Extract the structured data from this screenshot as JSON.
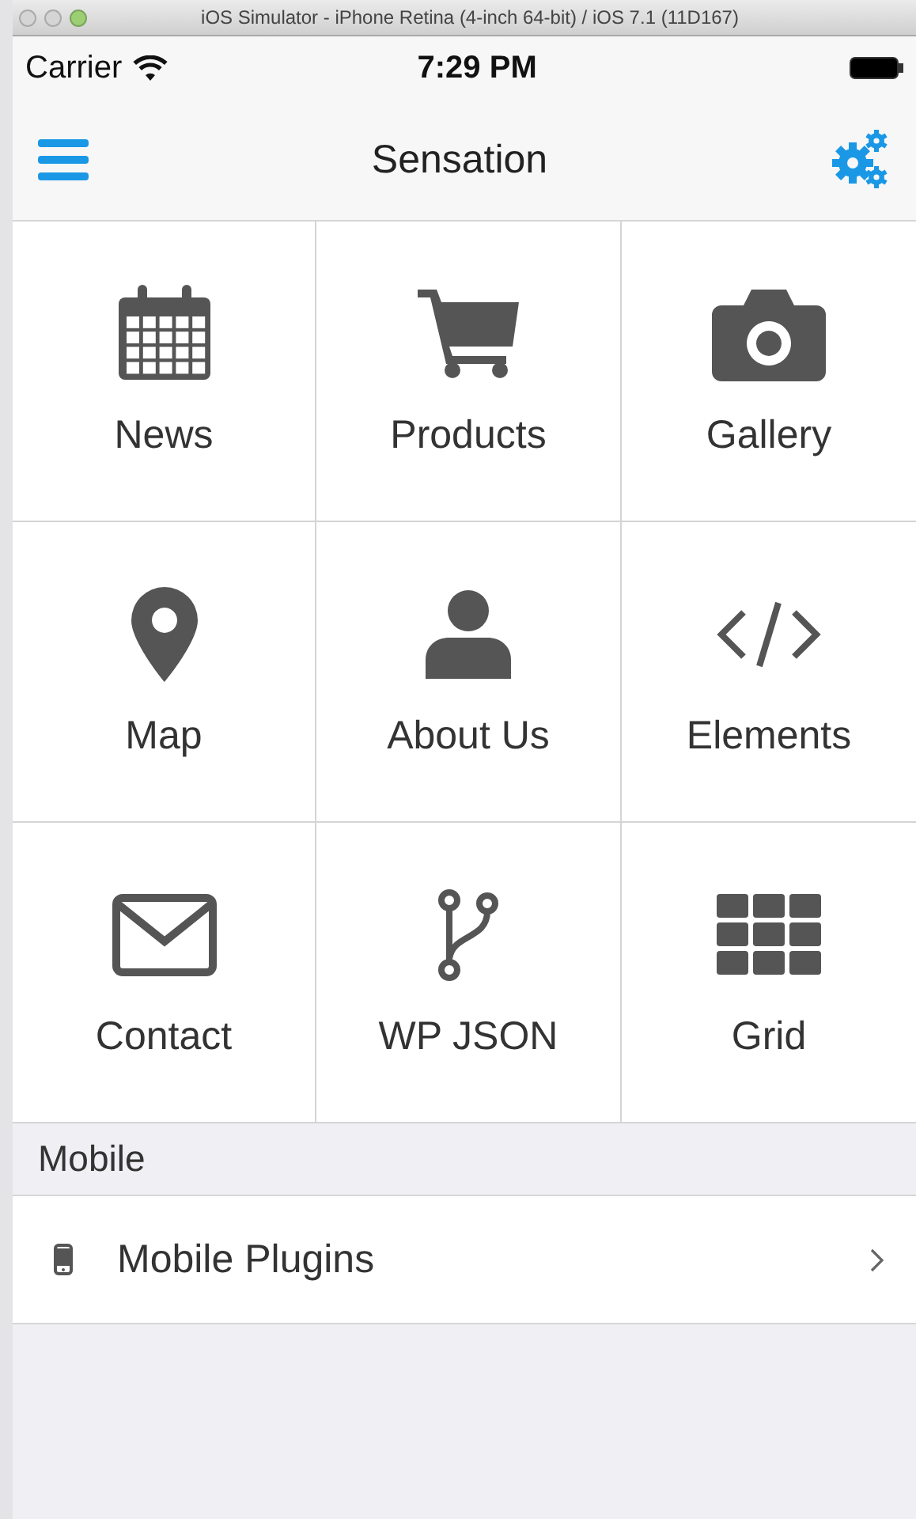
{
  "window": {
    "title": "iOS Simulator - iPhone Retina (4-inch 64-bit) / iOS 7.1 (11D167)"
  },
  "status_bar": {
    "carrier": "Carrier",
    "time": "7:29 PM"
  },
  "nav_bar": {
    "title": "Sensation"
  },
  "tiles": [
    {
      "label": "News"
    },
    {
      "label": "Products"
    },
    {
      "label": "Gallery"
    },
    {
      "label": "Map"
    },
    {
      "label": "About Us"
    },
    {
      "label": "Elements"
    },
    {
      "label": "Contact"
    },
    {
      "label": "WP JSON"
    },
    {
      "label": "Grid"
    }
  ],
  "section": {
    "header": "Mobile",
    "items": [
      {
        "label": "Mobile Plugins"
      }
    ]
  }
}
